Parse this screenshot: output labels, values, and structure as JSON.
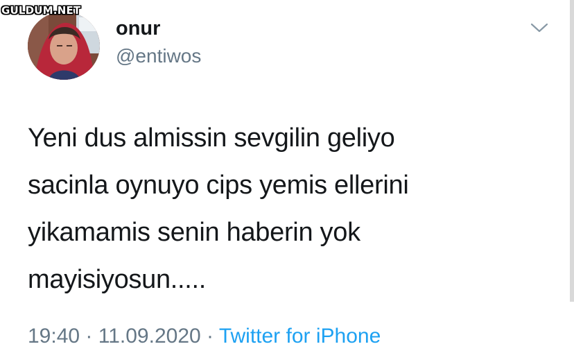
{
  "watermark": "GULDUM.NET",
  "tweet": {
    "display_name": "onur",
    "handle": "@entiwos",
    "text_lines": [
      "Yeni dus almissin sevgilin geliyo",
      "sacinla oynuyo cips yemis ellerini",
      "yikamamis senin haberin yok",
      "mayisiyosun....."
    ],
    "time": "19:40",
    "separator": "·",
    "date": "11.09.2020",
    "source": "Twitter for iPhone"
  },
  "icons": {
    "menu": "chevron-down-icon",
    "avatar": "profile-photo"
  },
  "colors": {
    "primary_text": "#14171a",
    "secondary_text": "#657786",
    "link": "#1da1f2",
    "background": "#ffffff"
  }
}
